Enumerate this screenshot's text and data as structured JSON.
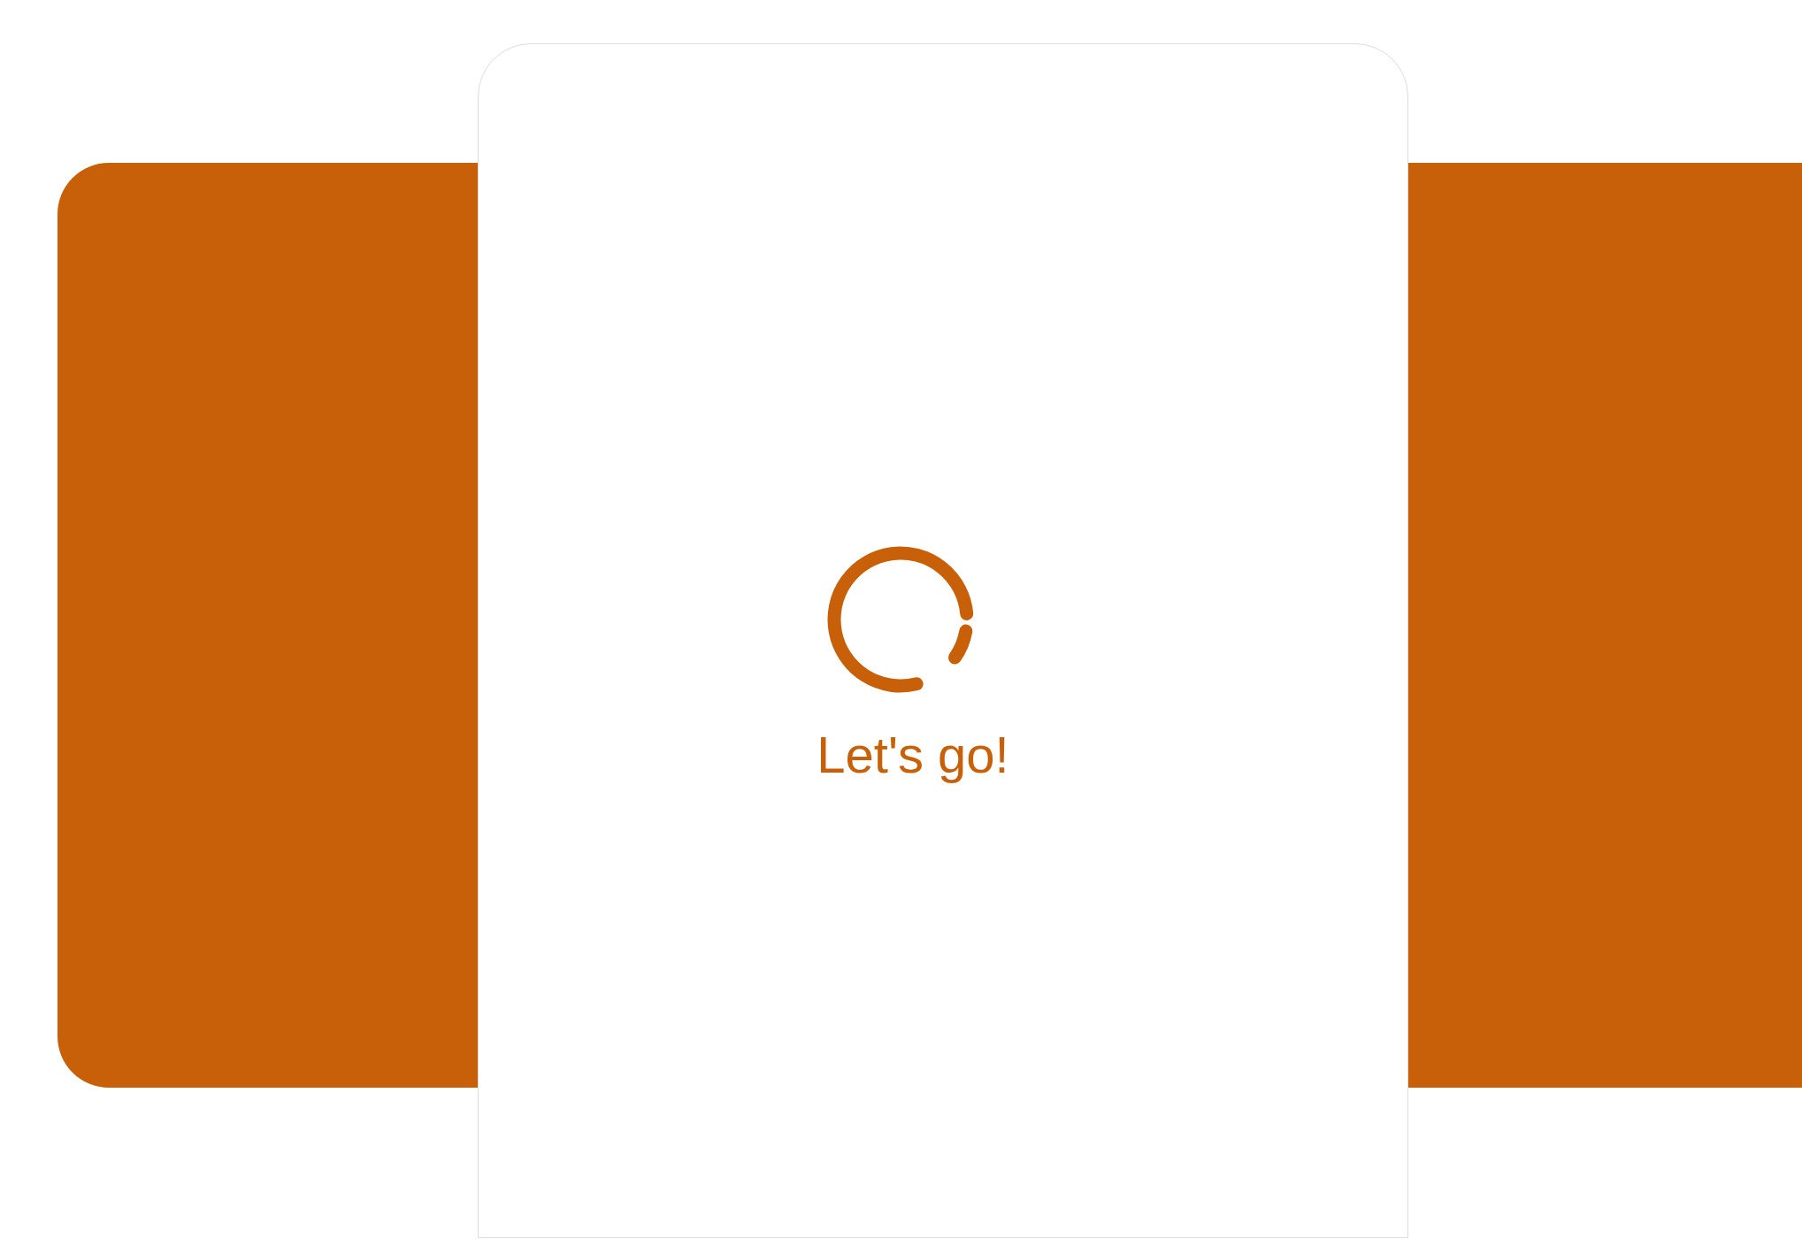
{
  "loading_card": {
    "message": "Let's go!"
  }
}
